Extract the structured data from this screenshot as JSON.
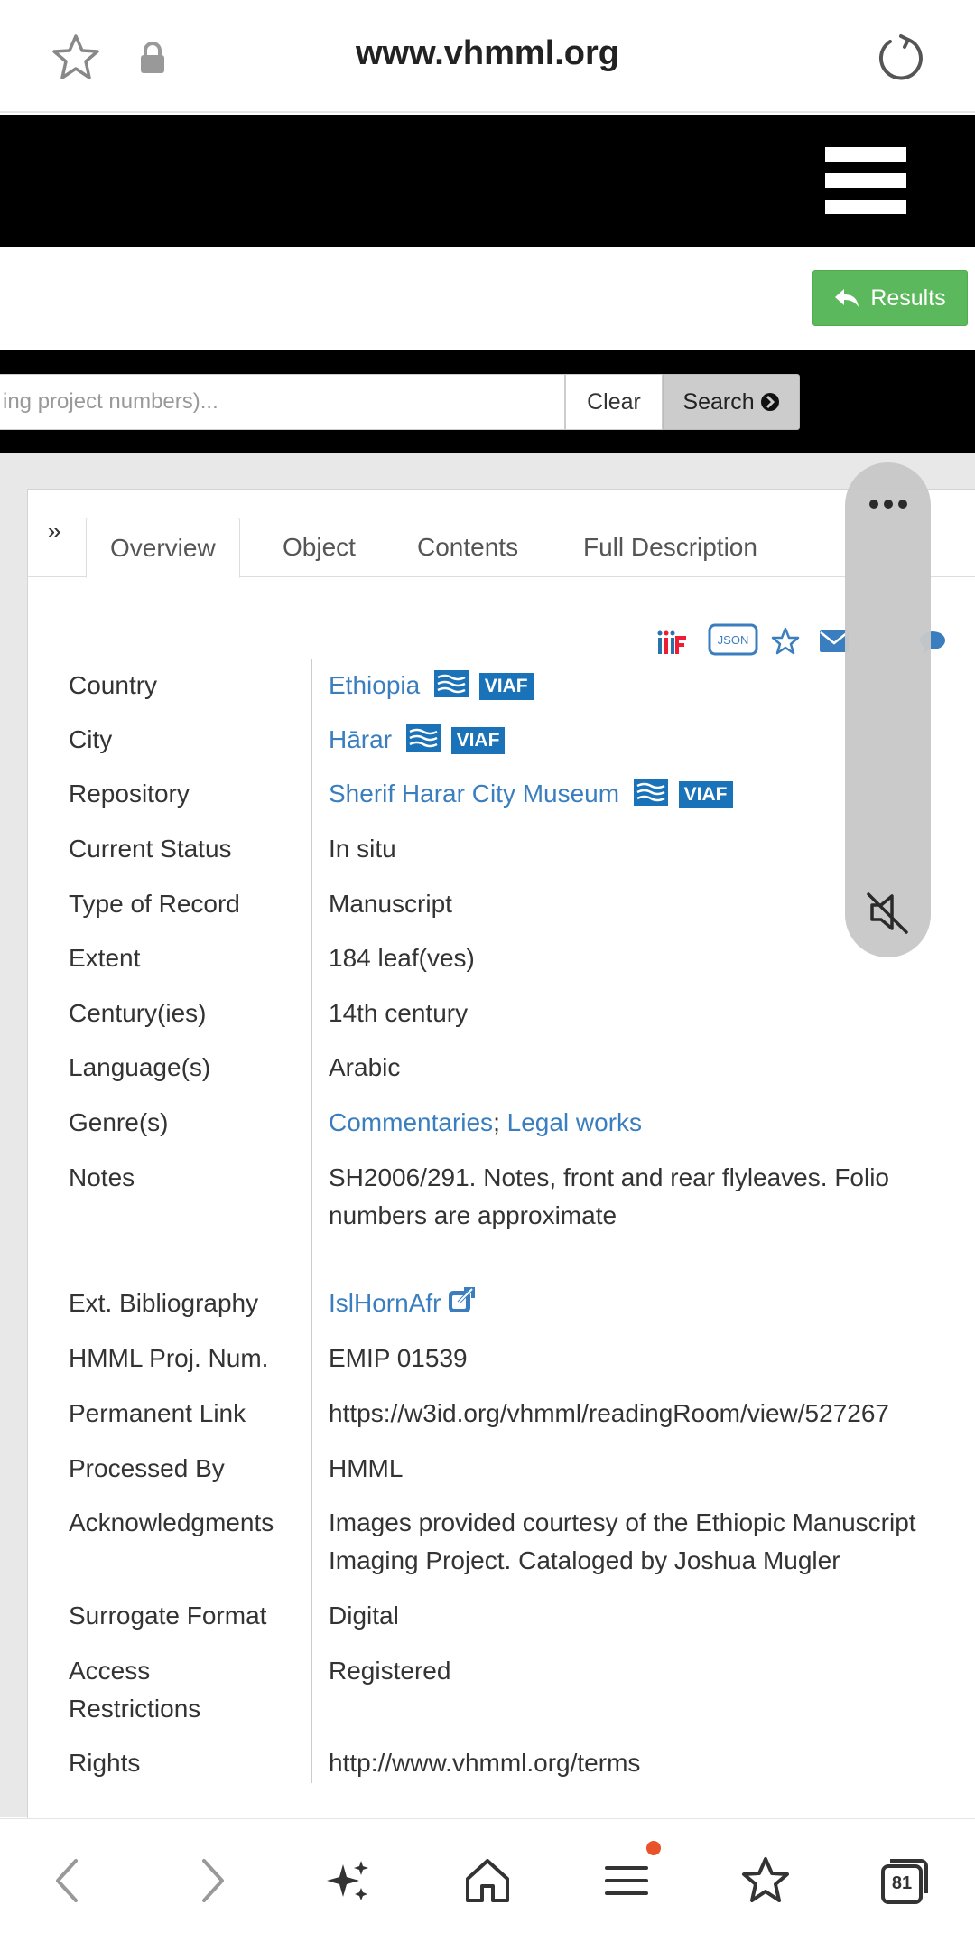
{
  "browser": {
    "url": "www.vhmml.org",
    "tab_count": "81"
  },
  "header": {
    "results_label": "Results"
  },
  "search": {
    "placeholder": "ing project numbers)...",
    "clear_label": "Clear",
    "search_label": "Search"
  },
  "tabs": {
    "collapse": "»",
    "overview": "Overview",
    "object": "Object",
    "contents": "Contents",
    "full_description": "Full Description"
  },
  "tools": {
    "json_label": "JSON"
  },
  "record": {
    "country_label": "Country",
    "country": "Ethiopia",
    "city_label": "City",
    "city": "Hārar",
    "repository_label": "Repository",
    "repository": "Sherif Harar City Museum",
    "viaf": "VIAF",
    "status_label": "Current Status",
    "status": "In situ",
    "type_label": "Type of Record",
    "type": "Manuscript",
    "extent_label": "Extent",
    "extent": "184 leaf(ves)",
    "century_label": "Century(ies)",
    "century": "14th century",
    "language_label": "Language(s)",
    "language": "Arabic",
    "genre_label": "Genre(s)",
    "genre_1": "Commentaries",
    "genre_sep": ";",
    "genre_2": "Legal works",
    "notes_label": "Notes",
    "notes": "SH2006/291. Notes, front and rear flyleaves. Folio numbers are approximate",
    "bibliography_label": "Ext. Bibliography",
    "bibliography": "IslHornAfr",
    "proj_label": "HMML Proj. Num.",
    "proj": "EMIP 01539",
    "permalink_label": "Permanent Link",
    "permalink": "https://w3id.org/vhmml/readingRoom/view/527267",
    "processed_label": "Processed By",
    "processed": "HMML",
    "ack_label": "Acknowledgments",
    "ack": "Images provided courtesy of the Ethiopic Manuscript Imaging Project. Cataloged by Joshua Mugler",
    "surrogate_label": "Surrogate Format",
    "surrogate": "Digital",
    "access_label": "Access Restrictions",
    "access": "Registered",
    "rights_label": "Rights",
    "rights": "http://www.vhmml.org/terms"
  }
}
